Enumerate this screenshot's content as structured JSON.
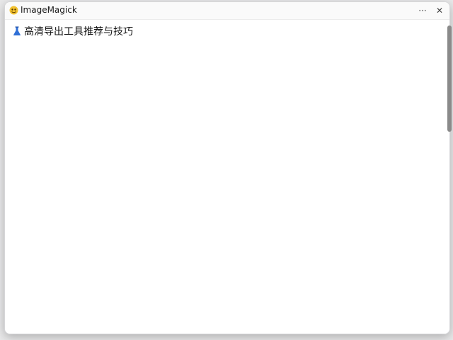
{
  "window": {
    "title": "ImageMagick",
    "app_icon": "imagemagick-logo-icon",
    "controls": {
      "more_icon": "more-icon",
      "more_glyph": "···",
      "close_icon": "close-icon",
      "close_glyph": "✕"
    }
  },
  "content": {
    "heading_icon": "blue-flask-icon",
    "heading": "高清导出工具推荐与技巧"
  },
  "colors": {
    "window_bg": "#ffffff",
    "titlebar_bg": "#fafafa",
    "accent_blue": "#2f6fd6",
    "scrollbar": "#8a8a8a"
  }
}
